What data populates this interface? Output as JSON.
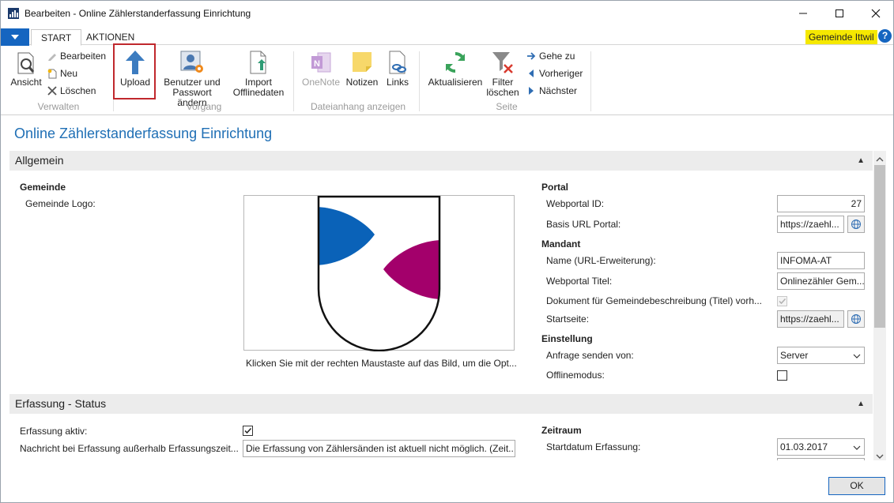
{
  "window": {
    "title": "Bearbeiten - Online Zählerstanderfassung Einrichtung"
  },
  "tabs": [
    {
      "label": "START"
    },
    {
      "label": "AKTIONEN"
    }
  ],
  "company_badge": "Gemeinde Ittwil",
  "help_label": "?",
  "ribbon": {
    "verwalten": {
      "label": "Verwalten",
      "ansicht": "Ansicht",
      "bearbeiten": "Bearbeiten",
      "neu": "Neu",
      "loeschen": "Löschen"
    },
    "vorgang": {
      "label": "Vorgang",
      "upload": "Upload",
      "benutzer_1": "Benutzer und",
      "benutzer_2": "Passwort ändern",
      "import_1": "Import",
      "import_2": "Offlinedaten"
    },
    "dateianhang": {
      "label": "Dateianhang anzeigen",
      "onenote": "OneNote",
      "notizen": "Notizen",
      "links": "Links"
    },
    "seite": {
      "label": "Seite",
      "aktualisieren": "Aktualisieren",
      "filter_1": "Filter",
      "filter_2": "löschen",
      "gehe_zu": "Gehe zu",
      "vorheriger": "Vorheriger",
      "naechster": "Nächster"
    }
  },
  "page_title": "Online Zählerstanderfassung Einrichtung",
  "allgemein": {
    "title": "Allgemein",
    "gemeinde_heading": "Gemeinde",
    "logo_label": "Gemeinde Logo:",
    "logo_hint": "Klicken Sie mit der rechten Maustaste auf das Bild, um die Opt...",
    "portal_heading": "Portal",
    "webportal_id_label": "Webportal ID:",
    "webportal_id": "27",
    "basis_url_label": "Basis URL Portal:",
    "basis_url": "https://zaehl...",
    "mandant_heading": "Mandant",
    "name_label": "Name (URL-Erweiterung):",
    "name": "INFOMA-AT",
    "webportal_titel_label": "Webportal Titel:",
    "webportal_titel": "Onlinezähler Gem...",
    "dokument_label": "Dokument für Gemeindebeschreibung (Titel) vorh...",
    "startseite_label": "Startseite:",
    "startseite": "https://zaehl...",
    "einstellung_heading": "Einstellung",
    "anfrage_label": "Anfrage senden von:",
    "anfrage": "Server",
    "offline_label": "Offlinemodus:"
  },
  "erfassung": {
    "title": "Erfassung - Status",
    "aktiv_label": "Erfassung aktiv:",
    "nachricht_label": "Nachricht bei Erfassung außerhalb Erfassungszeit...",
    "nachricht": "Die Erfassung von Zählersänden ist aktuell nicht möglich. (Zeit...",
    "zeitraum_heading": "Zeitraum",
    "startdatum_label": "Startdatum Erfassung:",
    "startdatum": "01.03.2017"
  },
  "ok_label": "OK",
  "colors": {
    "accent": "#1565c0",
    "title_blue": "#1f6fb5",
    "badge": "#f5e800",
    "logo_blue": "#0a62b8",
    "logo_magenta": "#a3006b",
    "highlight": "#c0282d"
  }
}
